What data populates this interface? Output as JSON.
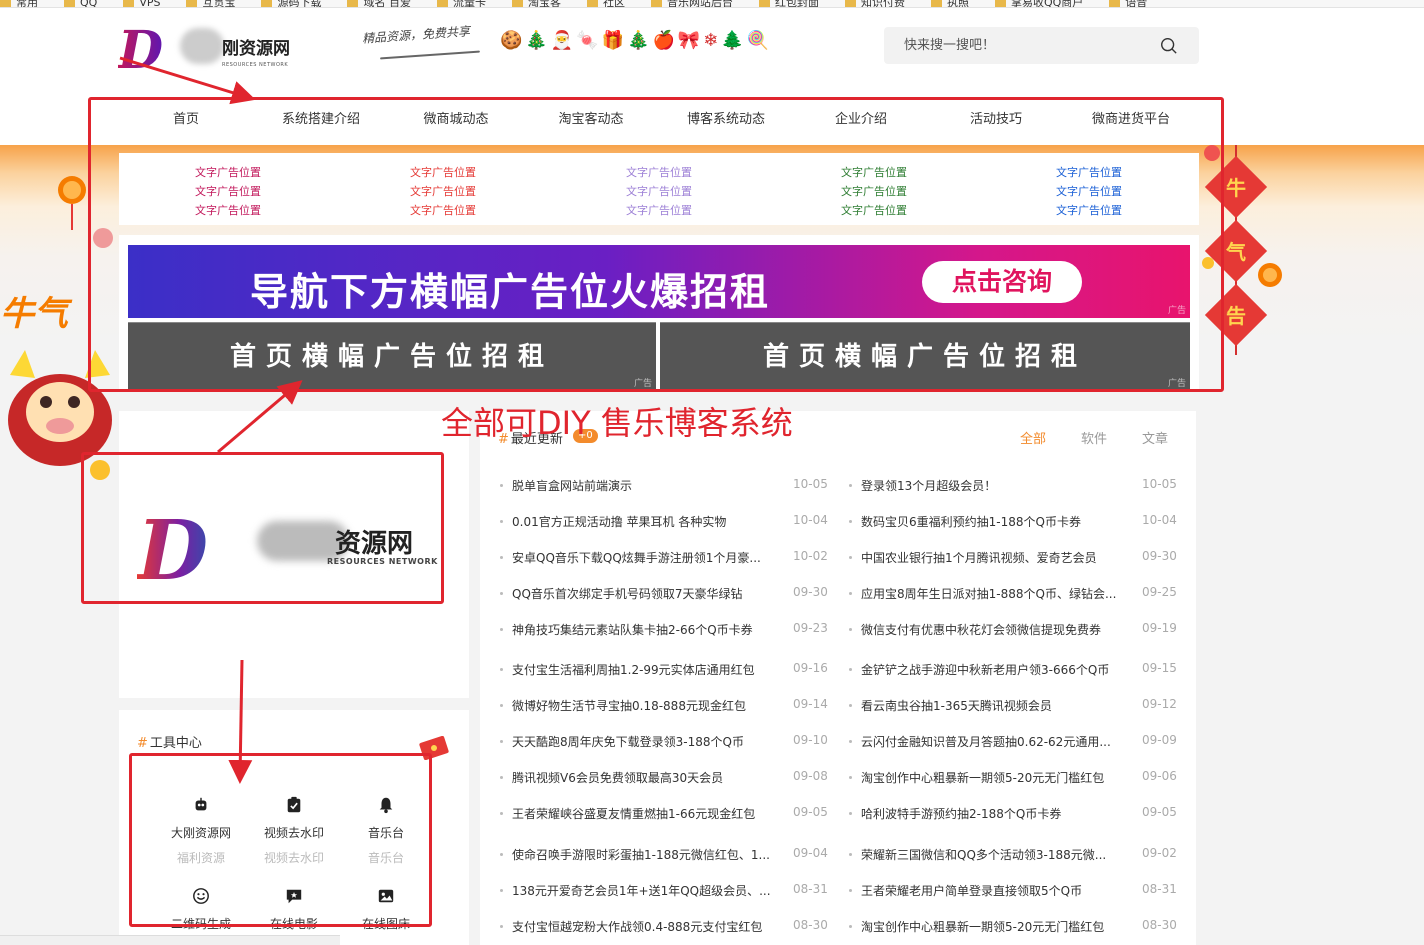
{
  "bookmarks": [
    "常用",
    "QQ",
    "VPS",
    "互贯宝",
    "源码下载",
    "域名 百爱",
    "流量卡",
    "淘宝客",
    "社区",
    "音乐网站后台",
    "红包封面",
    "知识付费",
    "执照",
    "掌易收QQ商户",
    "语音"
  ],
  "header": {
    "logo_letter": "D",
    "logo_text": "刚资源网",
    "logo_sub": "RESOURCES NETWORK",
    "slogan": "精品资源，免费共享",
    "festive_icons": "🍪🎄🎅🍬🎁🎄🍎🎀❄🌲🍭",
    "search_placeholder": "快来搜一搜吧！"
  },
  "nav": [
    "首页",
    "系统搭建介绍",
    "微商城动态",
    "淘宝客动态",
    "博客系统动态",
    "企业介绍",
    "活动技巧",
    "微商进货平台"
  ],
  "text_ads": {
    "label": "文字广告位置",
    "columns": [
      {
        "color": "#c2185b"
      },
      {
        "color": "#e53935"
      },
      {
        "color": "#9c7fd6"
      },
      {
        "color": "#2e7d32"
      },
      {
        "color": "#1a5fd6"
      }
    ]
  },
  "banners": {
    "main_text": "导航下方横幅广告位火爆招租",
    "main_button": "点击咨询",
    "ad_tag": "广告",
    "secondary_text": "首页横幅广告位招租"
  },
  "annotation": "全部可DIY 售乐博客系统",
  "big_logo": {
    "letter": "D",
    "text": "资源网",
    "sub": "RESOURCES NETWORK"
  },
  "tools": {
    "title": "工具中心",
    "items": [
      {
        "name": "大刚资源网",
        "sub": "福利资源",
        "icon": "bot-icon"
      },
      {
        "name": "视频去水印",
        "sub": "视频去水印",
        "icon": "clipboard-check-icon"
      },
      {
        "name": "音乐台",
        "sub": "音乐台",
        "icon": "bell-icon"
      },
      {
        "name": "二维码生成",
        "icon": "smile-icon"
      },
      {
        "name": "在线电影",
        "icon": "message-star-icon"
      },
      {
        "name": "在线图床",
        "icon": "image-icon"
      }
    ]
  },
  "updates": {
    "hash": "#",
    "title": "最近更新",
    "count": "+0",
    "filters": [
      "全部",
      "软件",
      "文章"
    ],
    "active_color": "#f38b2c",
    "left": [
      {
        "title": "脱单盲盒网站前端演示",
        "date": "10-05"
      },
      {
        "title": "0.01官方正规活动撸 苹果耳机 各种实物",
        "date": "10-04"
      },
      {
        "title": "安卓QQ音乐下载QQ炫舞手游注册领1个月豪...",
        "date": "10-02"
      },
      {
        "title": "QQ音乐首次绑定手机号码领取7天豪华绿钻",
        "date": "09-30"
      },
      {
        "title": "神角技巧集结元素站队集卡抽2-66个Q币卡券",
        "date": "09-23"
      },
      {
        "title": "支付宝生活福利周抽1.2-99元实体店通用红包",
        "date": "09-16"
      },
      {
        "title": "微博好物生活节寻宝抽0.18-888元现金红包",
        "date": "09-14"
      },
      {
        "title": "天天酷跑8周年庆免下载登录领3-188个Q币",
        "date": "09-10"
      },
      {
        "title": "腾讯视频V6会员免费领取最高30天会员",
        "date": "09-08"
      },
      {
        "title": "王者荣耀峡谷盛夏友情重燃抽1-66元现金红包",
        "date": "09-05"
      },
      {
        "title": "使命召唤手游限时彩蛋抽1-188元微信红包、1...",
        "date": "09-04"
      },
      {
        "title": "138元开爱奇艺会员1年+送1年QQ超级会员、...",
        "date": "08-31"
      },
      {
        "title": "支付宝恒越宠粉大作战领0.4-888元支付宝红包",
        "date": "08-30"
      }
    ],
    "right": [
      {
        "title": "登录领13个月超级会员！",
        "date": "10-05"
      },
      {
        "title": "数码宝贝6重福利预约抽1-188个Q币卡券",
        "date": "10-04"
      },
      {
        "title": "中国农业银行抽1个月腾讯视频、爱奇艺会员",
        "date": "09-30"
      },
      {
        "title": "应用宝8周年生日派对抽1-888个Q币、绿钻会...",
        "date": "09-25"
      },
      {
        "title": "微信支付有优惠中秋花灯会领微信提现免费券",
        "date": "09-19"
      },
      {
        "title": "金铲铲之战手游迎中秋新老用户领3-666个Q币",
        "date": "09-15"
      },
      {
        "title": "看云南虫谷抽1-365天腾讯视频会员",
        "date": "09-12"
      },
      {
        "title": "云闪付金融知识普及月答题抽0.62-62元通用...",
        "date": "09-09"
      },
      {
        "title": "淘宝创作中心粗暴新一期领5-20元无门槛红包",
        "date": "09-06"
      },
      {
        "title": "哈利波特手游预约抽2-188个Q币卡券",
        "date": "09-05"
      },
      {
        "title": "荣耀新三国微信和QQ多个活动领3-188元微...",
        "date": "09-02"
      },
      {
        "title": "王者荣耀老用户简单登录直接领取5个Q币",
        "date": "08-31"
      },
      {
        "title": "淘宝创作中心粗暴新一期领5-20元无门槛红包",
        "date": "08-30"
      }
    ]
  }
}
